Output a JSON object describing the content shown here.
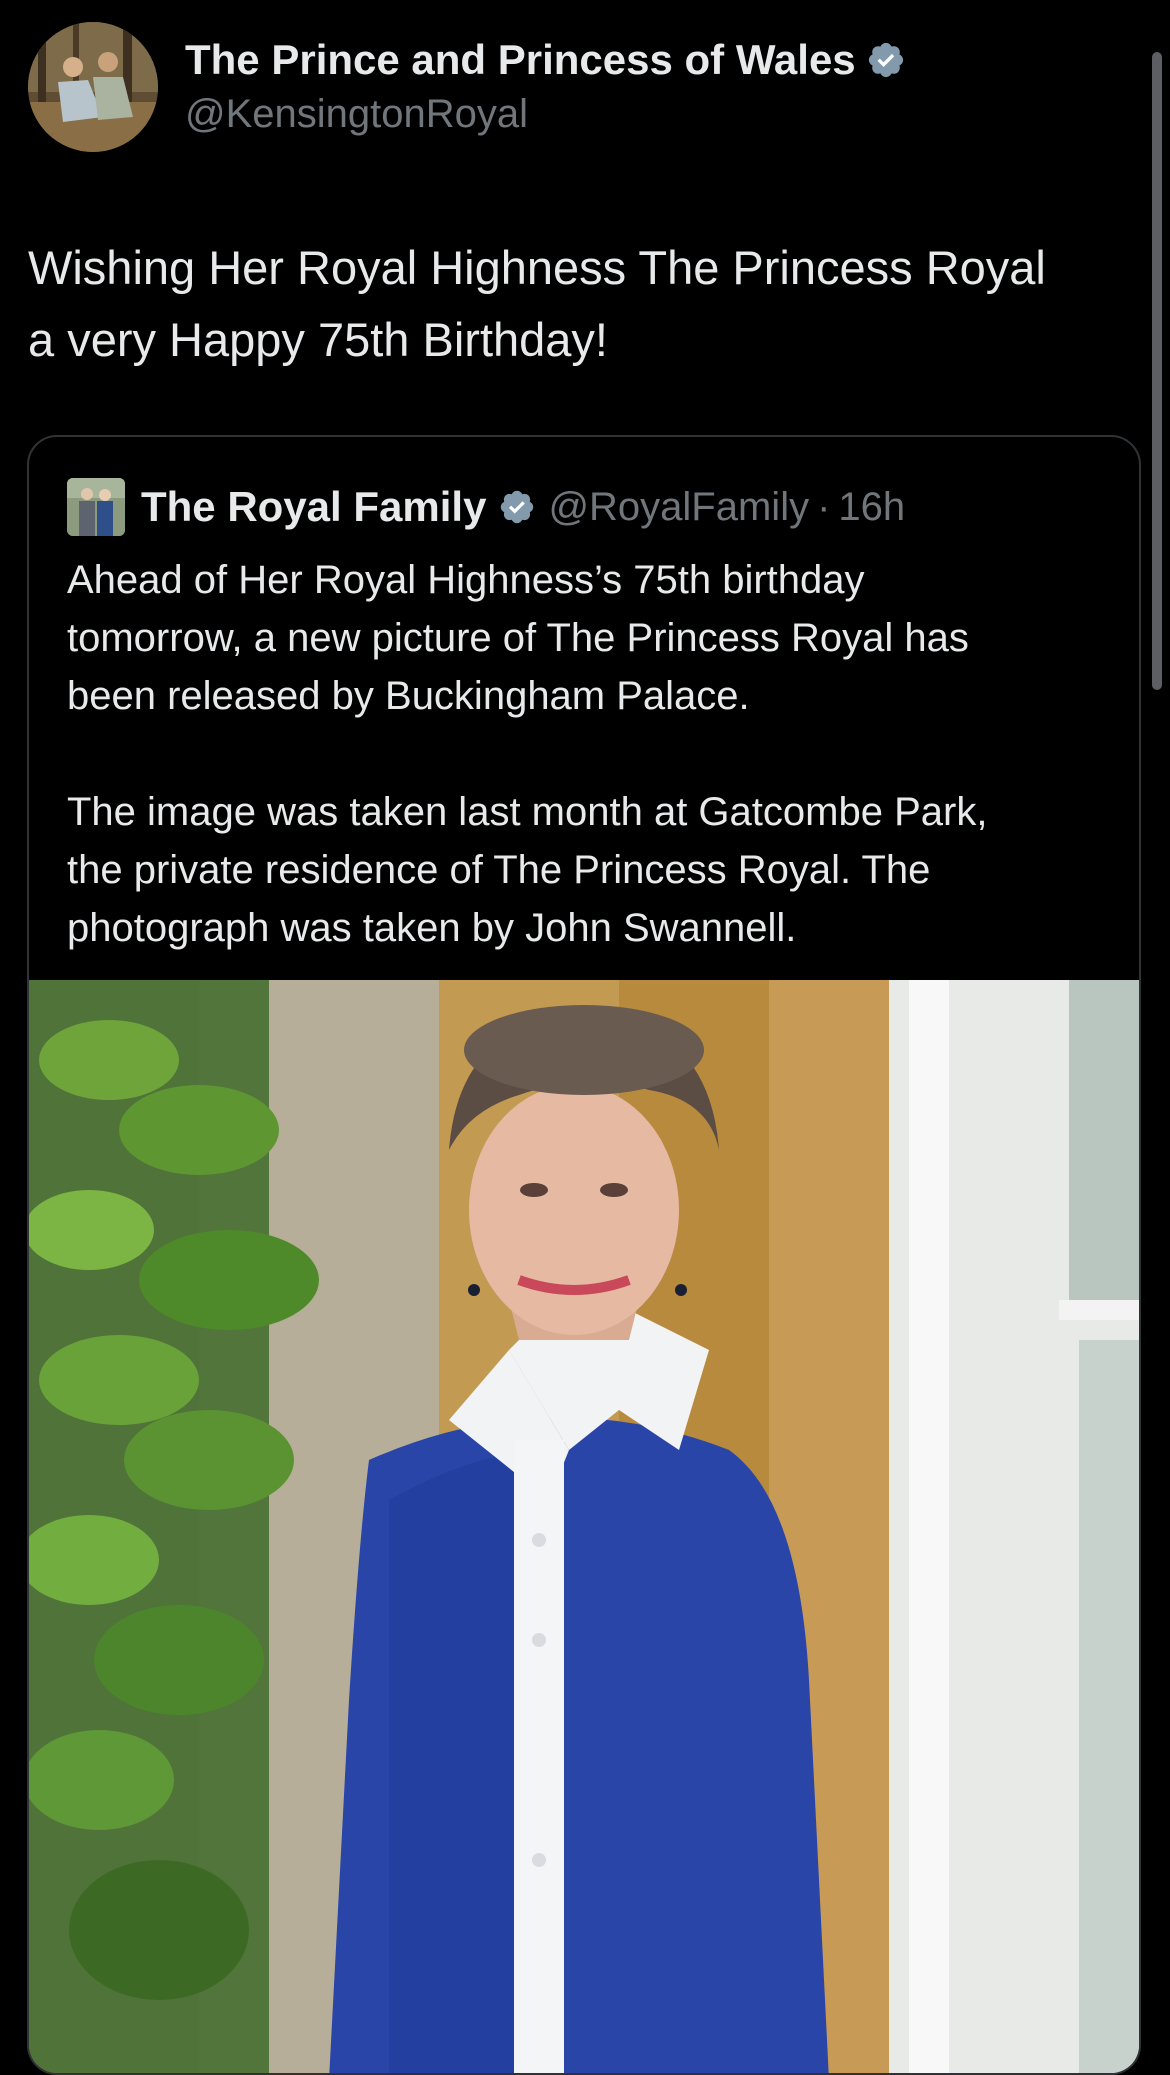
{
  "tweet": {
    "author_name": "The Prince and Princess of Wales",
    "author_handle": "@KensingtonRoyal",
    "avatar_icon": "profile-photo-couple-outdoors",
    "verified_icon": "verified-badge-icon",
    "text_lines": [
      "Wishing Her Royal Highness The Princess Royal",
      "a very Happy 75th Birthday!"
    ]
  },
  "quote": {
    "author_name": "The Royal Family",
    "author_handle": "@RoyalFamily",
    "separator": "·",
    "time": "16h",
    "avatar_icon": "profile-photo-king-and-queen",
    "paragraph_1_lines": [
      "Ahead of Her Royal Highness’s 75th birthday",
      "tomorrow, a new picture of The Princess Royal has",
      "been released by Buckingham Palace."
    ],
    "paragraph_2_lines": [
      "The image was taken last month at Gatcombe Park,",
      "the private residence of The Princess Royal. The",
      "photograph was taken by John Swannell."
    ],
    "photo_description": "portrait-photo"
  },
  "colors": {
    "background": "#000000",
    "text_primary": "#e7e9ea",
    "text_secondary": "#71767b",
    "border": "#2f3336",
    "verified": "#829aab"
  }
}
